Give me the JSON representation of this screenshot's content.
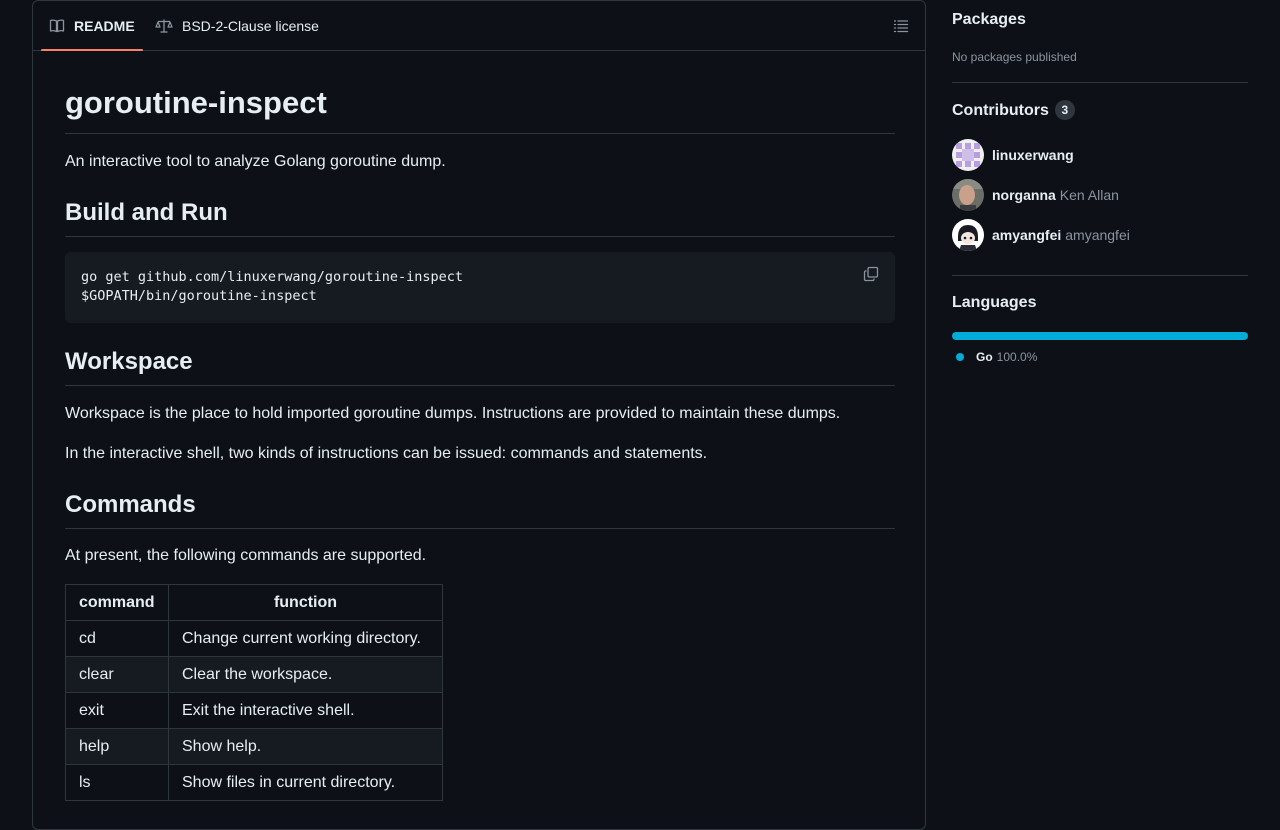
{
  "tabs": {
    "readme": "README",
    "license": "BSD-2-Clause license"
  },
  "readme": {
    "title": "goroutine-inspect",
    "intro": "An interactive tool to analyze Golang goroutine dump.",
    "build_heading": "Build and Run",
    "code_lines": [
      "go get github.com/linuxerwang/goroutine-inspect",
      "$GOPATH/bin/goroutine-inspect"
    ],
    "workspace_heading": "Workspace",
    "workspace_p1": "Workspace is the place to hold imported goroutine dumps. Instructions are provided to maintain these dumps.",
    "workspace_p2": "In the interactive shell, two kinds of instructions can be issued: commands and statements.",
    "commands_heading": "Commands",
    "commands_intro": "At present, the following commands are supported.",
    "table": {
      "headers": [
        "command",
        "function"
      ],
      "rows": [
        [
          "cd",
          "Change current working directory."
        ],
        [
          "clear",
          "Clear the workspace."
        ],
        [
          "exit",
          "Exit the interactive shell."
        ],
        [
          "help",
          "Show help."
        ],
        [
          "ls",
          "Show files in current directory."
        ]
      ]
    }
  },
  "sidebar": {
    "packages_heading": "Packages",
    "packages_text": "No packages published",
    "contributors_heading": "Contributors",
    "contributors_count": "3",
    "contributors": [
      {
        "login": "linuxerwang",
        "name": ""
      },
      {
        "login": "norganna",
        "name": "Ken Allan"
      },
      {
        "login": "amyangfei",
        "name": "amyangfei"
      }
    ],
    "languages_heading": "Languages",
    "language": {
      "name": "Go",
      "percent": "100.0%",
      "fraction": 1.0,
      "color": "#00ADD8"
    }
  },
  "icons": {
    "readme_tab": "book-icon",
    "license_tab": "law-icon",
    "outline": "list-unordered-icon",
    "copy": "copy-icon"
  }
}
